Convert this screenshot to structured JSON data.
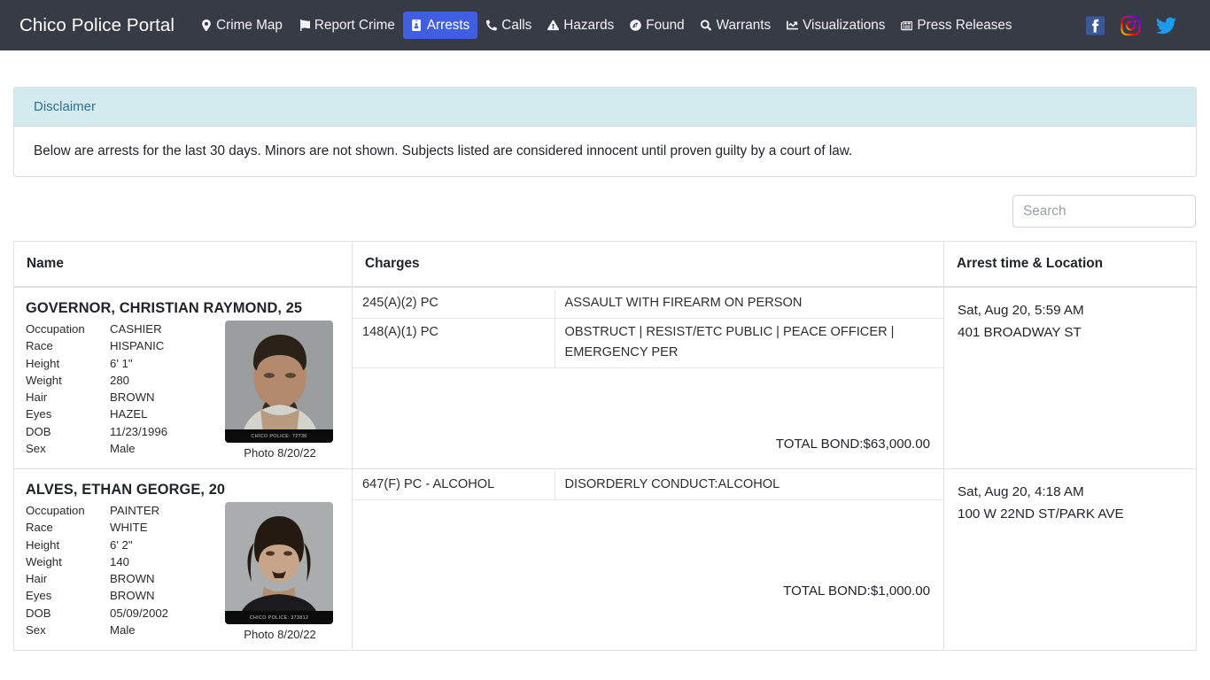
{
  "navbar": {
    "brand": "Chico Police Portal",
    "items": [
      {
        "label": "Crime Map",
        "icon": "map-pin-icon",
        "active": false
      },
      {
        "label": "Report Crime",
        "icon": "flag-icon",
        "active": false
      },
      {
        "label": "Arrests",
        "icon": "id-badge-icon",
        "active": true
      },
      {
        "label": "Calls",
        "icon": "phone-icon",
        "active": false
      },
      {
        "label": "Hazards",
        "icon": "warning-icon",
        "active": false
      },
      {
        "label": "Found",
        "icon": "compass-icon",
        "active": false
      },
      {
        "label": "Warrants",
        "icon": "search-icon",
        "active": false
      },
      {
        "label": "Visualizations",
        "icon": "chart-icon",
        "active": false
      },
      {
        "label": "Press Releases",
        "icon": "newspaper-icon",
        "active": false
      }
    ],
    "social": [
      {
        "name": "facebook-icon",
        "label": "Facebook"
      },
      {
        "name": "instagram-icon",
        "label": "Instagram"
      },
      {
        "name": "twitter-icon",
        "label": "Twitter"
      }
    ],
    "colors": {
      "background": "#373b45",
      "active_pill": "#3f5fe0",
      "text": "#f2f3f5"
    }
  },
  "disclaimer": {
    "title": "Disclaimer",
    "body": "Below are arrests for the last 30 days. Minors are not shown. Subjects listed are considered innocent until proven guilty by a court of law.",
    "header_bg": "#d3eaee",
    "header_text_color": "#31708f"
  },
  "search": {
    "value": "",
    "placeholder": "Search"
  },
  "table": {
    "headers": {
      "name": "Name",
      "charges": "Charges",
      "arrest": "Arrest time & Location"
    },
    "attr_labels": {
      "occupation": "Occupation",
      "race": "Race",
      "height": "Height",
      "weight": "Weight",
      "hair": "Hair",
      "eyes": "Eyes",
      "dob": "DOB",
      "sex": "Sex"
    },
    "bond_label": "TOTAL BOND:",
    "rows": [
      {
        "name": "GOVERNOR, CHRISTIAN RAYMOND, 25",
        "attrs": {
          "occupation": "CASHIER",
          "race": "HISPANIC",
          "height": "6' 1\"",
          "weight": "280",
          "hair": "BROWN",
          "eyes": "HAZEL",
          "dob": "11/23/1996",
          "sex": "Male"
        },
        "photo": {
          "watermark": "CHICO POLICE: 72736",
          "caption": "Photo 8/20/22"
        },
        "charges": [
          {
            "code": "245(A)(2) PC",
            "description": "ASSAULT WITH FIREARM ON PERSON"
          },
          {
            "code": "148(A)(1) PC",
            "description": "OBSTRUCT | RESIST/ETC PUBLIC | PEACE OFFICER | EMERGENCY PER"
          }
        ],
        "total_bond": "TOTAL BOND:$63,000.00",
        "arrest_time": "Sat, Aug 20, 5:59 AM",
        "arrest_location": "401 BROADWAY ST"
      },
      {
        "name": "ALVES, ETHAN GEORGE, 20",
        "attrs": {
          "occupation": "PAINTER",
          "race": "WHITE",
          "height": "6' 2\"",
          "weight": "140",
          "hair": "BROWN",
          "eyes": "BROWN",
          "dob": "05/09/2002",
          "sex": "Male"
        },
        "photo": {
          "watermark": "CHICO POLICE: 373812",
          "caption": "Photo 8/20/22"
        },
        "charges": [
          {
            "code": "647(F) PC - ALCOHOL",
            "description": "DISORDERLY CONDUCT:ALCOHOL"
          }
        ],
        "total_bond": "TOTAL BOND:$1,000.00",
        "arrest_time": "Sat, Aug 20, 4:18 AM",
        "arrest_location": "100 W 22ND ST/PARK AVE"
      }
    ]
  }
}
